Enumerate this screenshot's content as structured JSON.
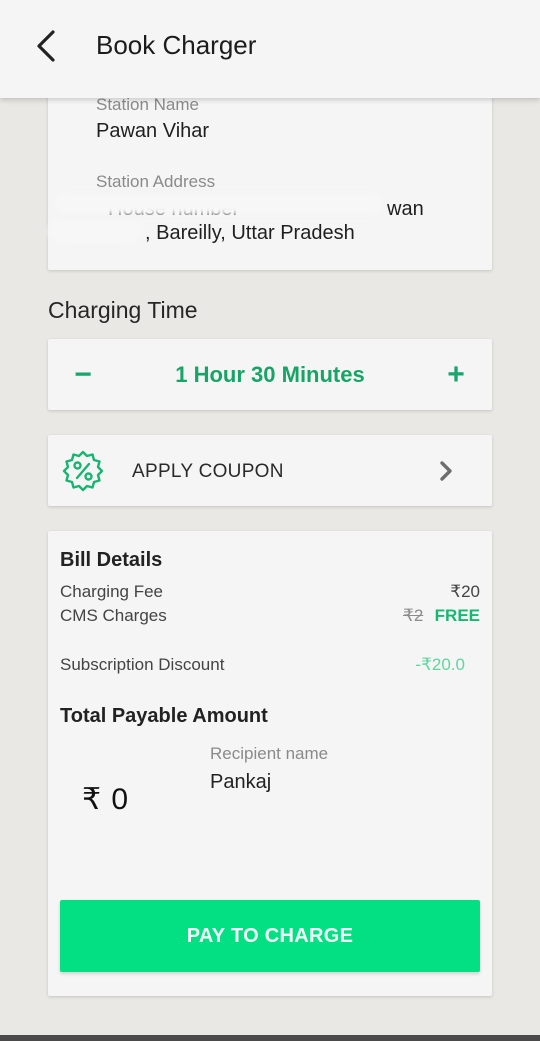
{
  "appbar": {
    "title": "Book Charger",
    "back_icon": "arrow-left-icon"
  },
  "station": {
    "name_label": "Station Name",
    "name_value": "Pawan Vihar",
    "address_label": "Station Address",
    "address_line1_left": "House number",
    "address_line1_right": "wan",
    "address_line2": ", Bareilly, Uttar Pradesh"
  },
  "charging_time": {
    "heading": "Charging Time",
    "value": "1 Hour 30 Minutes",
    "decrement_label": "−",
    "increment_label": "+"
  },
  "coupon": {
    "label": "APPLY COUPON",
    "icon": "discount-badge-icon",
    "chevron_icon": "chevron-right-icon"
  },
  "bill": {
    "title": "Bill Details",
    "rows": [
      {
        "label": "Charging Fee",
        "amount": "₹20"
      },
      {
        "label": "CMS Charges",
        "original_amount": "₹2",
        "amount": "FREE"
      },
      {
        "label": "Subscription Discount",
        "amount": "-₹20.0"
      }
    ],
    "total_label": "Total Payable Amount",
    "total_amount": "₹ 0",
    "recipient_label": "Recipient name",
    "recipient_value": "Pankaj"
  },
  "pay_button": {
    "label": "PAY TO CHARGE"
  },
  "colors": {
    "accent": "#17a466",
    "pay_button": "#02e083",
    "free": "#18b872",
    "discount": "#5fd69e",
    "background": "#e9e8e5",
    "card": "#f5f5f5"
  }
}
